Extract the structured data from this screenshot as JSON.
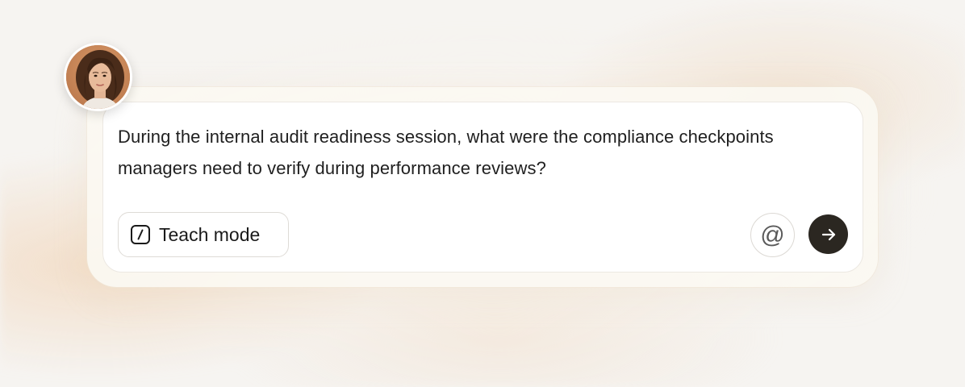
{
  "prompt": {
    "text": "During the internal audit readiness session, what were the compliance checkpoints managers need to verify during performance reviews?"
  },
  "toolbar": {
    "teach_mode_label": "Teach mode",
    "teach_mode_icon": "slash-square-icon",
    "mention_icon": "at-sign-icon",
    "mention_glyph": "@",
    "send_icon": "arrow-right-icon"
  },
  "user": {
    "avatar": "user-avatar-photo"
  },
  "colors": {
    "send_button": "#2b2721",
    "accent_glow": "#f0cdaa"
  }
}
